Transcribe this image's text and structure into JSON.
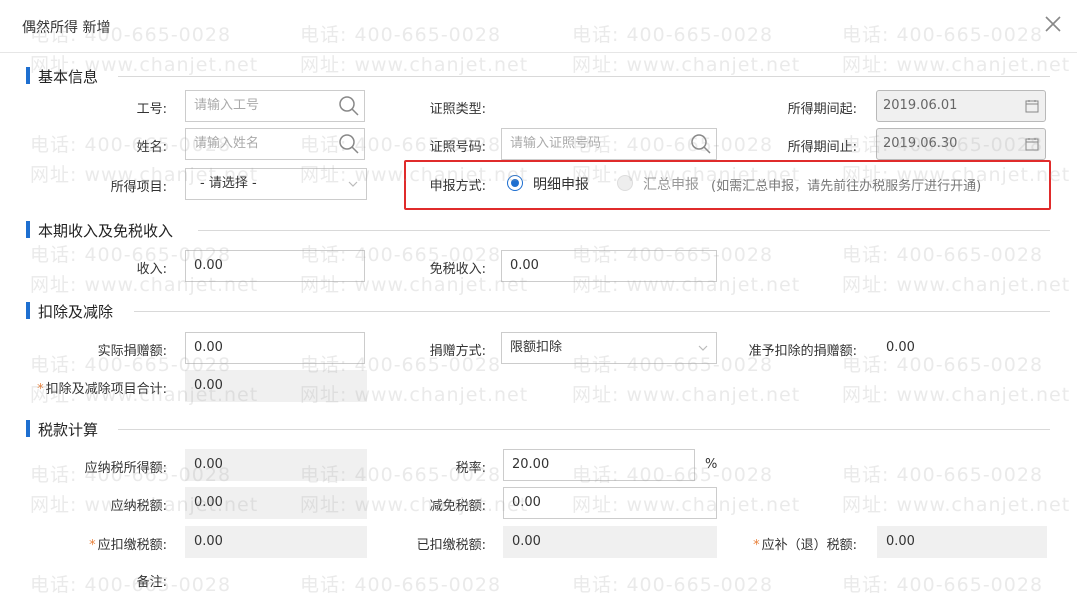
{
  "dialog": {
    "title": "偶然所得 新增"
  },
  "sections": {
    "basic": "基本信息",
    "income": "本期收入及免税收入",
    "deduction": "扣除及减除",
    "tax": "税款计算"
  },
  "basic": {
    "emp_no_label": "工号:",
    "emp_no_placeholder": "请输入工号",
    "name_label": "姓名:",
    "name_placeholder": "请输入姓名",
    "income_item_label": "所得项目:",
    "income_item_value": "- 请选择 -",
    "id_type_label": "证照类型:",
    "id_no_label": "证照号码:",
    "id_no_placeholder": "请输入证照号码",
    "period_start_label": "所得期间起:",
    "period_start_value": "2019.06.01",
    "period_end_label": "所得期间止:",
    "period_end_value": "2019.06.30",
    "declare_method_label": "申报方式:",
    "declare_options": [
      "明细申报",
      "汇总申报"
    ],
    "declare_selected": "明细申报",
    "declare_hint": "(如需汇总申报，请先前往办税服务厅进行开通)"
  },
  "income": {
    "income_label": "收入:",
    "income_value": "0.00",
    "exempt_label": "免税收入:",
    "exempt_value": "0.00"
  },
  "deduction": {
    "donation_label": "实际捐赠额:",
    "donation_value": "0.00",
    "donation_method_label": "捐赠方式:",
    "donation_method_value": "限额扣除",
    "allowed_donation_label": "准予扣除的捐赠额:",
    "allowed_donation_value": "0.00",
    "total_label": "扣除及减除项目合计:",
    "total_value": "0.00"
  },
  "tax": {
    "taxable_income_label": "应纳税所得额:",
    "taxable_income_value": "0.00",
    "rate_label": "税率:",
    "rate_value": "20.00",
    "rate_unit": "%",
    "tax_payable_label": "应纳税额:",
    "tax_payable_value": "0.00",
    "tax_relief_label": "减免税额:",
    "tax_relief_value": "0.00",
    "withholding_label": "应扣缴税额:",
    "withholding_value": "0.00",
    "withheld_label": "已扣缴税额:",
    "withheld_value": "0.00",
    "refund_label": "应补（退）税额:",
    "refund_value": "0.00",
    "remark_label": "备注:"
  },
  "watermark": {
    "phone": "电话: 400-665-0028",
    "site": "网址: www.chanjet.net"
  },
  "colors": {
    "accent": "#1e6fd0",
    "highlight": "#e02b2b",
    "required": "#e8803a"
  }
}
